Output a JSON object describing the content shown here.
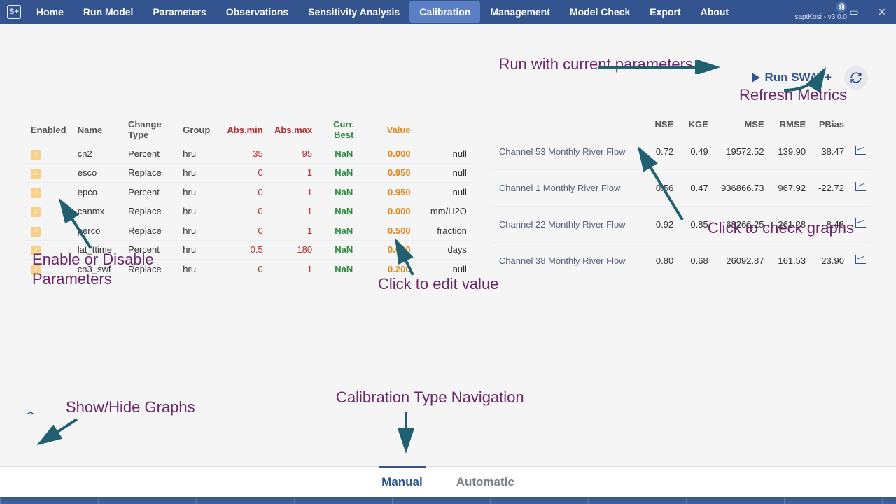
{
  "app": {
    "project": "saptKosi",
    "version": "v3.0.0",
    "logo": "S+"
  },
  "nav": {
    "items": [
      "Home",
      "Run Model",
      "Parameters",
      "Observations",
      "Sensitivity Analysis",
      "Calibration",
      "Management",
      "Model Check",
      "Export",
      "About"
    ],
    "active_index": 5
  },
  "toolbar": {
    "run_label": "Run SWAT+"
  },
  "annotations": {
    "run_params": "Run with current parameters",
    "refresh_metrics": "Refresh Metrics",
    "check_graphs": "Click to check graphs",
    "edit_value": "Click to edit value",
    "enable_disable": "Enable or Disable Parameters",
    "show_hide": "Show/Hide Graphs",
    "tab_nav": "Calibration Type Navigation"
  },
  "param_table": {
    "headers": {
      "enabled": "Enabled",
      "name": "Name",
      "change": "Change Type",
      "group": "Group",
      "absmin": "Abs.min",
      "absmax": "Abs.max",
      "curr": "Curr. Best",
      "value": "Value",
      "unit": ""
    },
    "rows": [
      {
        "enabled": true,
        "name": "cn2",
        "change": "Percent",
        "group": "hru",
        "absmin": "35",
        "absmax": "95",
        "curr": "NaN",
        "value": "0.000",
        "unit": "null"
      },
      {
        "enabled": true,
        "name": "esco",
        "change": "Replace",
        "group": "hru",
        "absmin": "0",
        "absmax": "1",
        "curr": "NaN",
        "value": "0.950",
        "unit": "null"
      },
      {
        "enabled": true,
        "name": "epco",
        "change": "Percent",
        "group": "hru",
        "absmin": "0",
        "absmax": "1",
        "curr": "NaN",
        "value": "0.950",
        "unit": "null"
      },
      {
        "enabled": true,
        "name": "canmx",
        "change": "Replace",
        "group": "hru",
        "absmin": "0",
        "absmax": "1",
        "curr": "NaN",
        "value": "0.000",
        "unit": "mm/H2O"
      },
      {
        "enabled": true,
        "name": "perco",
        "change": "Replace",
        "group": "hru",
        "absmin": "0",
        "absmax": "1",
        "curr": "NaN",
        "value": "0.500",
        "unit": "fraction"
      },
      {
        "enabled": true,
        "name": "lat_ttime",
        "change": "Percent",
        "group": "hru",
        "absmin": "0.5",
        "absmax": "180",
        "curr": "NaN",
        "value": "0.000",
        "unit": "days"
      },
      {
        "enabled": true,
        "name": "cn3_swf",
        "change": "Replace",
        "group": "hru",
        "absmin": "0",
        "absmax": "1",
        "curr": "NaN",
        "value": "0.200",
        "unit": "null"
      }
    ]
  },
  "metric_table": {
    "headers": {
      "series": "",
      "nse": "NSE",
      "kge": "KGE",
      "mse": "MSE",
      "rmse": "RMSE",
      "pbias": "PBias",
      "chart": ""
    },
    "rows": [
      {
        "series": "Channel 53 Monthly River Flow",
        "nse": "0.72",
        "kge": "0.49",
        "mse": "19572.52",
        "rmse": "139.90",
        "pbias": "38.47"
      },
      {
        "series": "Channel 1 Monthly River Flow",
        "nse": "0.56",
        "kge": "0.47",
        "mse": "936866.73",
        "rmse": "967.92",
        "pbias": "-22.72"
      },
      {
        "series": "Channel 22 Monthly River Flow",
        "nse": "0.92",
        "kge": "0.85",
        "mse": "68266.25",
        "rmse": "261.28",
        "pbias": "8.48"
      },
      {
        "series": "Channel 38 Monthly River Flow",
        "nse": "0.80",
        "kge": "0.68",
        "mse": "26092.87",
        "rmse": "161.53",
        "pbias": "23.90"
      }
    ]
  },
  "tabs": {
    "items": [
      "Manual",
      "Automatic"
    ],
    "active_index": 0
  }
}
